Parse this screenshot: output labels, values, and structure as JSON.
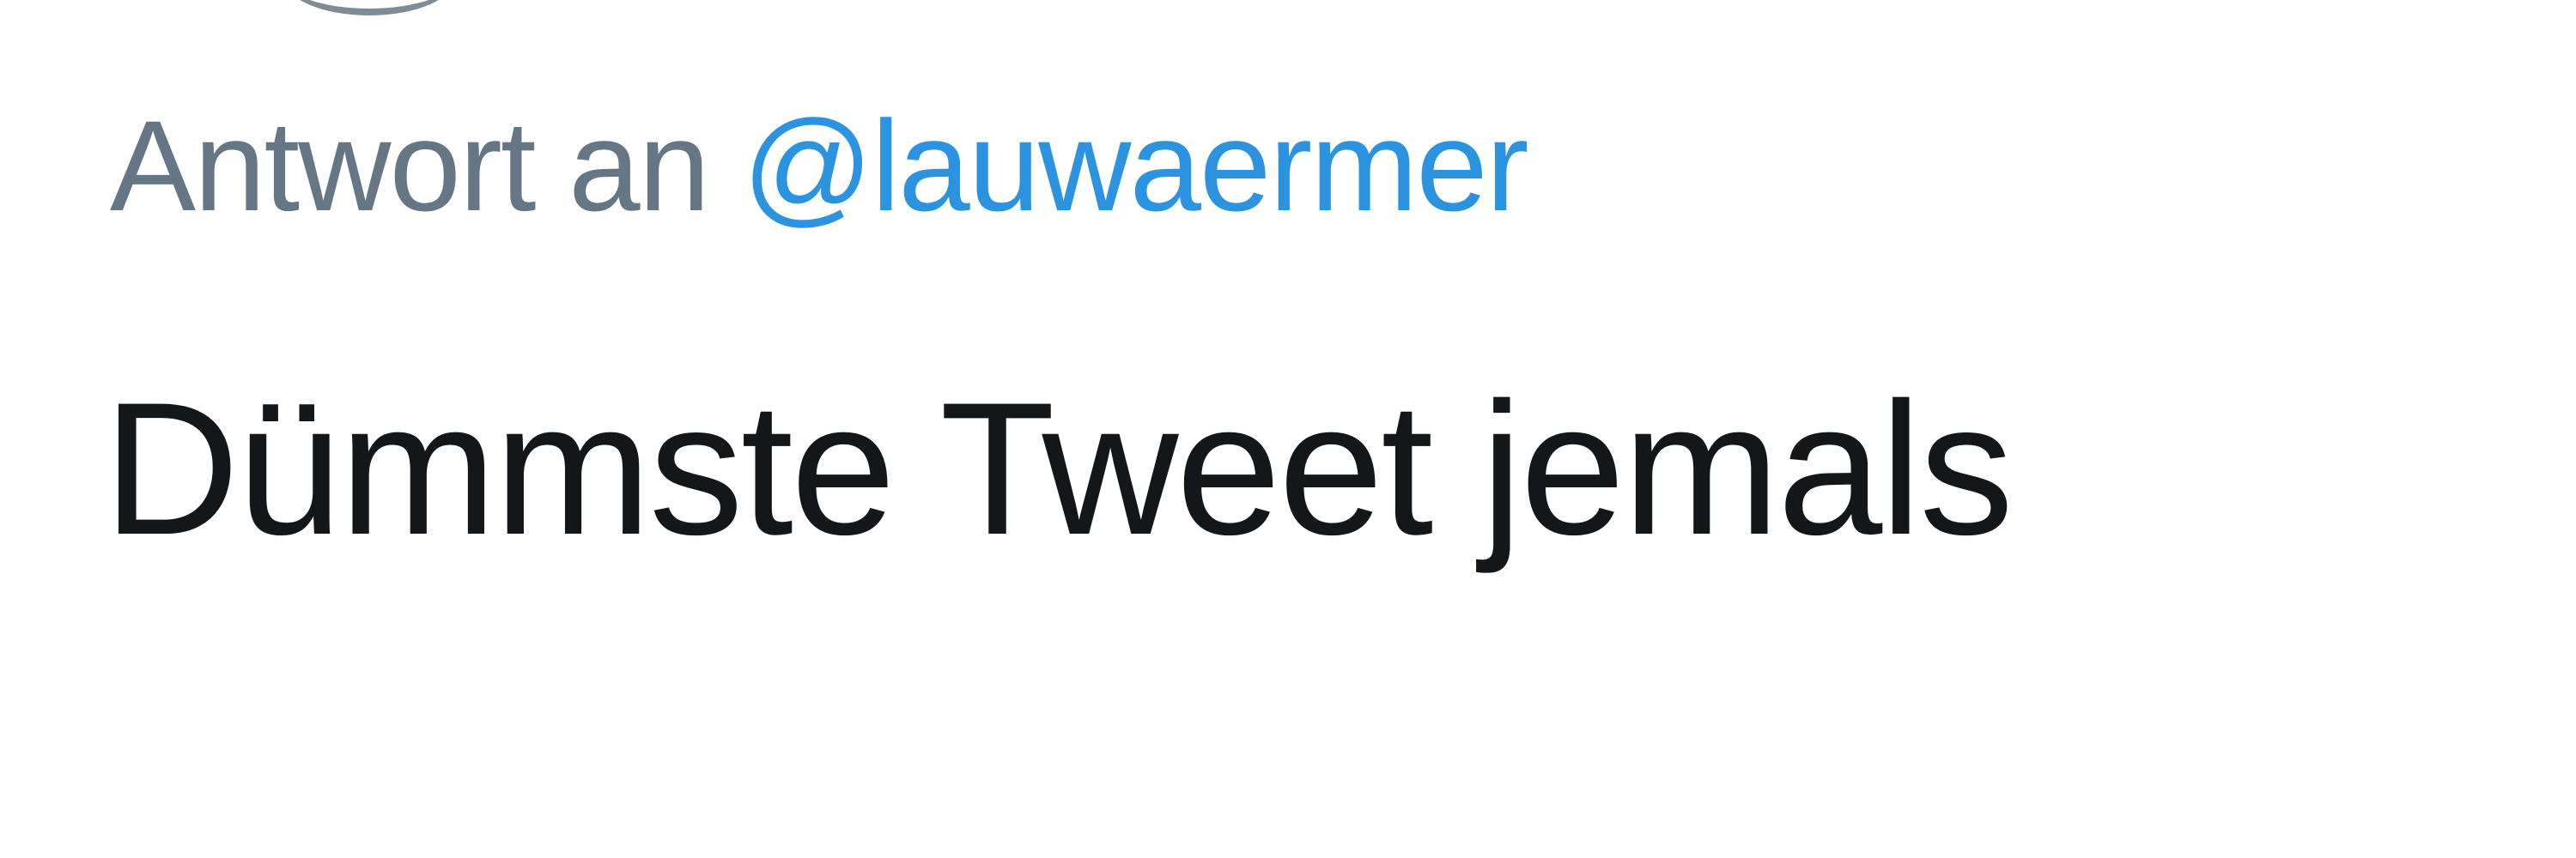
{
  "reply": {
    "prefix": "Antwort an",
    "mention": "@lauwaermer"
  },
  "tweet": {
    "text": "Dümmste Tweet jemals"
  },
  "colors": {
    "reply_text": "#657786",
    "mention": "#2b93e0",
    "tweet_text": "#14171a",
    "background": "#ffffff"
  }
}
